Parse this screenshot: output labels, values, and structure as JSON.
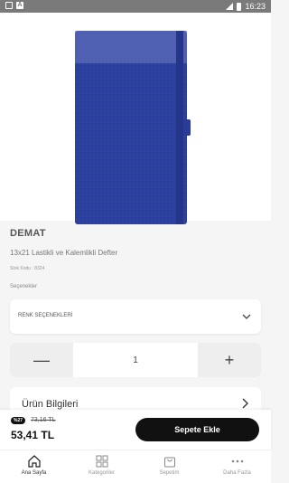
{
  "status_bar": {
    "time": "16:23"
  },
  "product": {
    "brand": "DEMAT",
    "name": "13x21 Lastikli ve Kalemlikli Defter",
    "stock_code": "Stok Kodu : 8324",
    "options_label": "Seçenekler",
    "image": {
      "color": "#2b3f9e"
    }
  },
  "color_select": {
    "placeholder": "RENK SEÇENEKLERİ"
  },
  "quantity": {
    "value": "1",
    "minus": "—",
    "plus": "+"
  },
  "info": {
    "title": "Ürün Bilgileri"
  },
  "pricing": {
    "discount_badge": "%27",
    "old_price": "73,16 TL",
    "new_price": "53,41 TL",
    "cart_button": "Sepete Ekle"
  },
  "tabs": [
    {
      "label": "Ana Sayfa",
      "icon": "home-icon",
      "active": true
    },
    {
      "label": "Kategoriler",
      "icon": "grid-icon",
      "active": false
    },
    {
      "label": "Sepetim",
      "icon": "bag-icon",
      "active": false
    },
    {
      "label": "Daha Fazla",
      "icon": "more-icon",
      "active": false
    }
  ]
}
